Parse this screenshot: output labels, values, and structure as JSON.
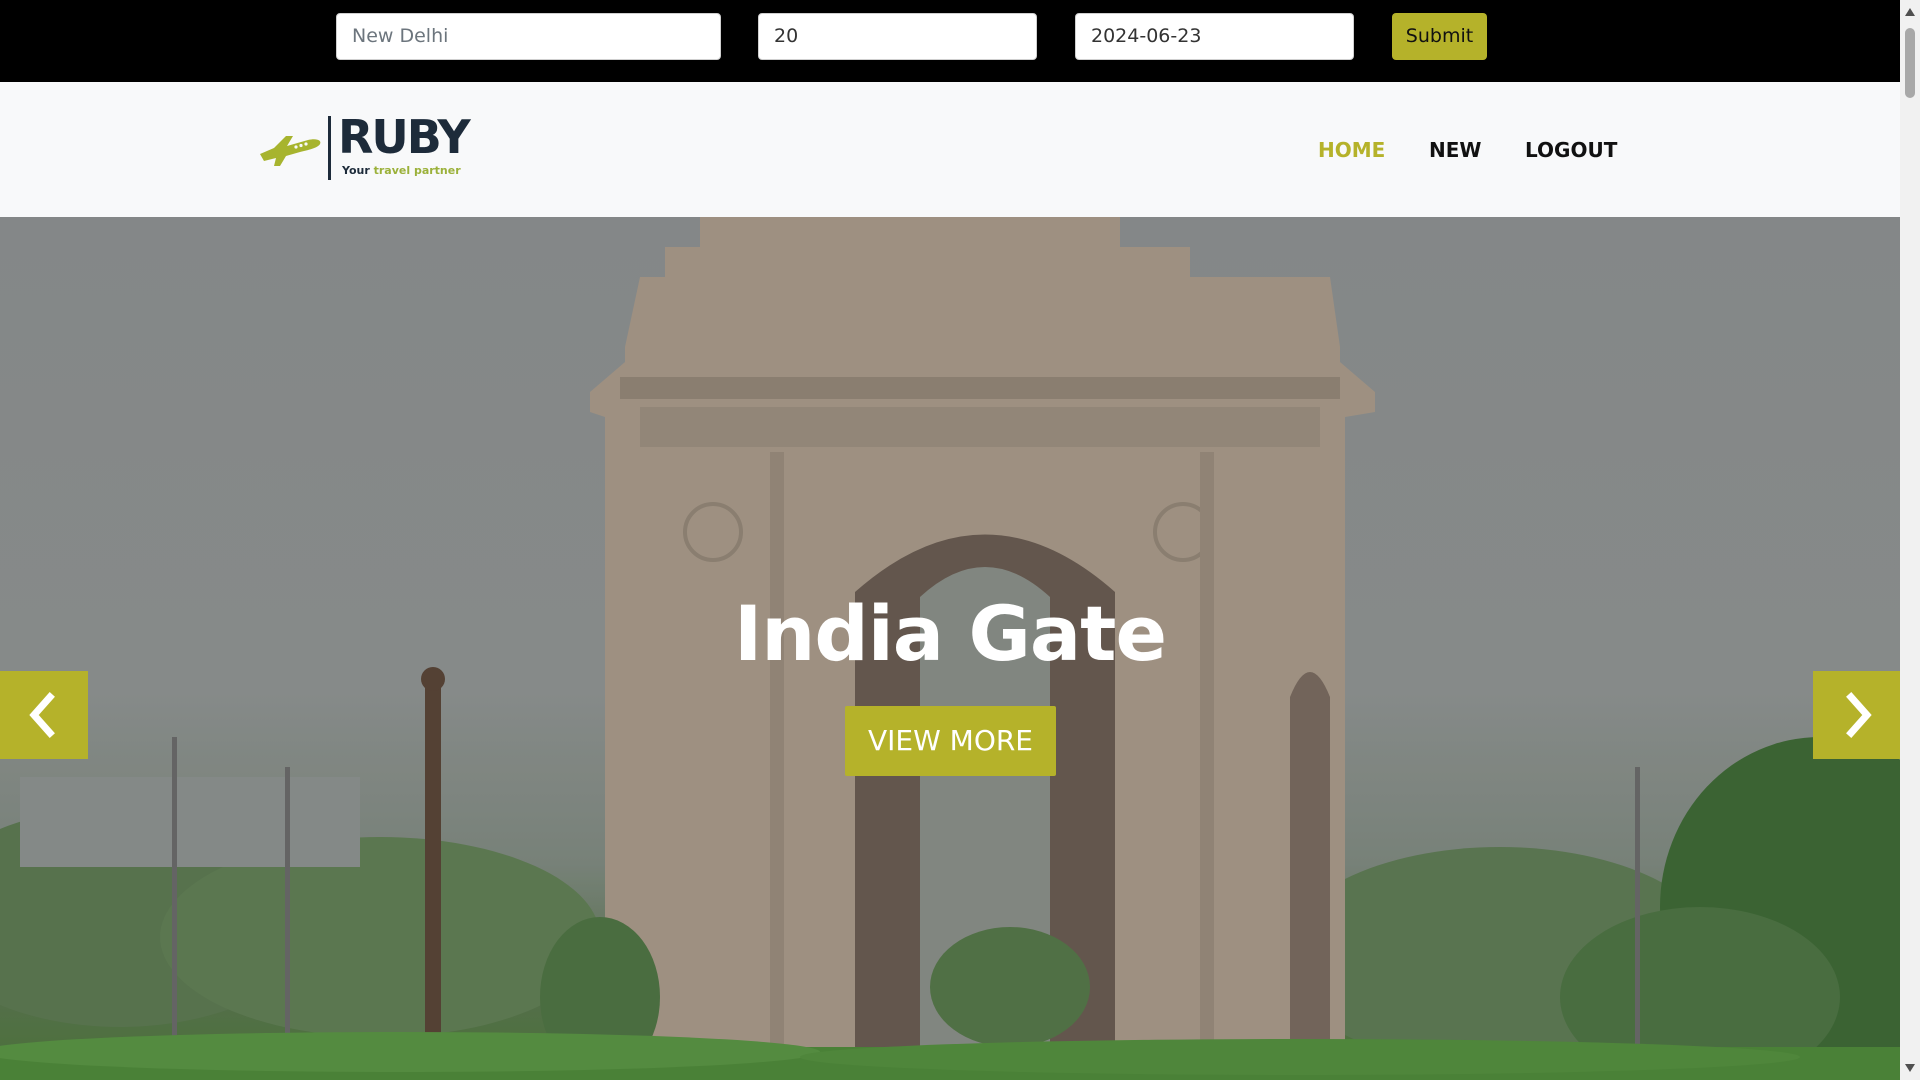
{
  "search": {
    "destination_value": "New Delhi",
    "guests_value": "20",
    "date_value": "2024-06-23",
    "submit_label": "Submit"
  },
  "logo": {
    "name": "RUBY",
    "tagline_prefix": "Your ",
    "tagline_accent": "travel partner"
  },
  "nav": {
    "home": "HOME",
    "new": "NEW",
    "logout": "LOGOUT"
  },
  "hero": {
    "title": "India Gate",
    "button_label": "VIEW MORE"
  },
  "icons": {
    "prev": "chevron-left-icon",
    "next": "chevron-right-icon",
    "logo": "airplane-icon"
  },
  "colors": {
    "accent": "#b5b22a",
    "nav_text": "#111111",
    "header_bg": "#f8f9fa",
    "search_bg": "#000000"
  }
}
